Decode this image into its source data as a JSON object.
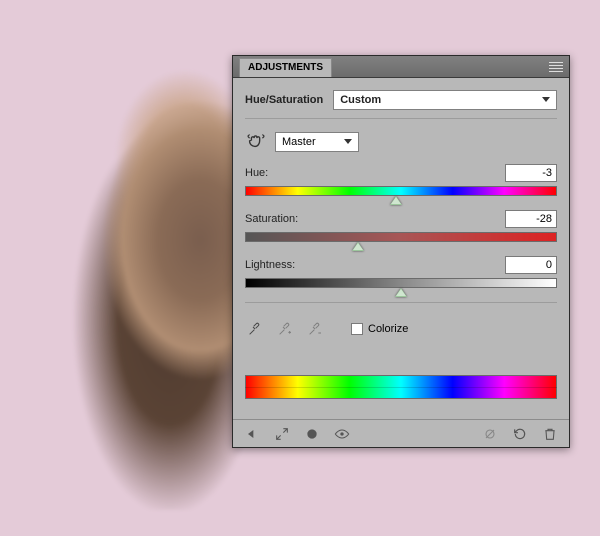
{
  "panel": {
    "title": "ADJUSTMENTS",
    "subtitle": "Hue/Saturation",
    "preset": "Custom",
    "channel": "Master",
    "hue": {
      "label": "Hue:",
      "value": "-3",
      "percent": 48.5
    },
    "sat": {
      "label": "Saturation:",
      "value": "-28",
      "percent": 36
    },
    "lig": {
      "label": "Lightness:",
      "value": "0",
      "percent": 50
    },
    "colorize": {
      "label": "Colorize",
      "checked": false
    }
  },
  "icons": {
    "hand": "scrubby-hand-icon",
    "eye1": "eyedropper-icon",
    "eye2": "eyedropper-plus-icon",
    "eye3": "eyedropper-minus-icon",
    "back": "back-arrow-icon",
    "expand": "expand-icon",
    "mask": "mask-circle-icon",
    "visibility": "visibility-icon",
    "clip": "clip-icon",
    "reset": "reset-icon",
    "trash": "trash-icon",
    "menu": "panel-menu-icon",
    "collapse": "collapse-icon",
    "close": "close-icon"
  }
}
